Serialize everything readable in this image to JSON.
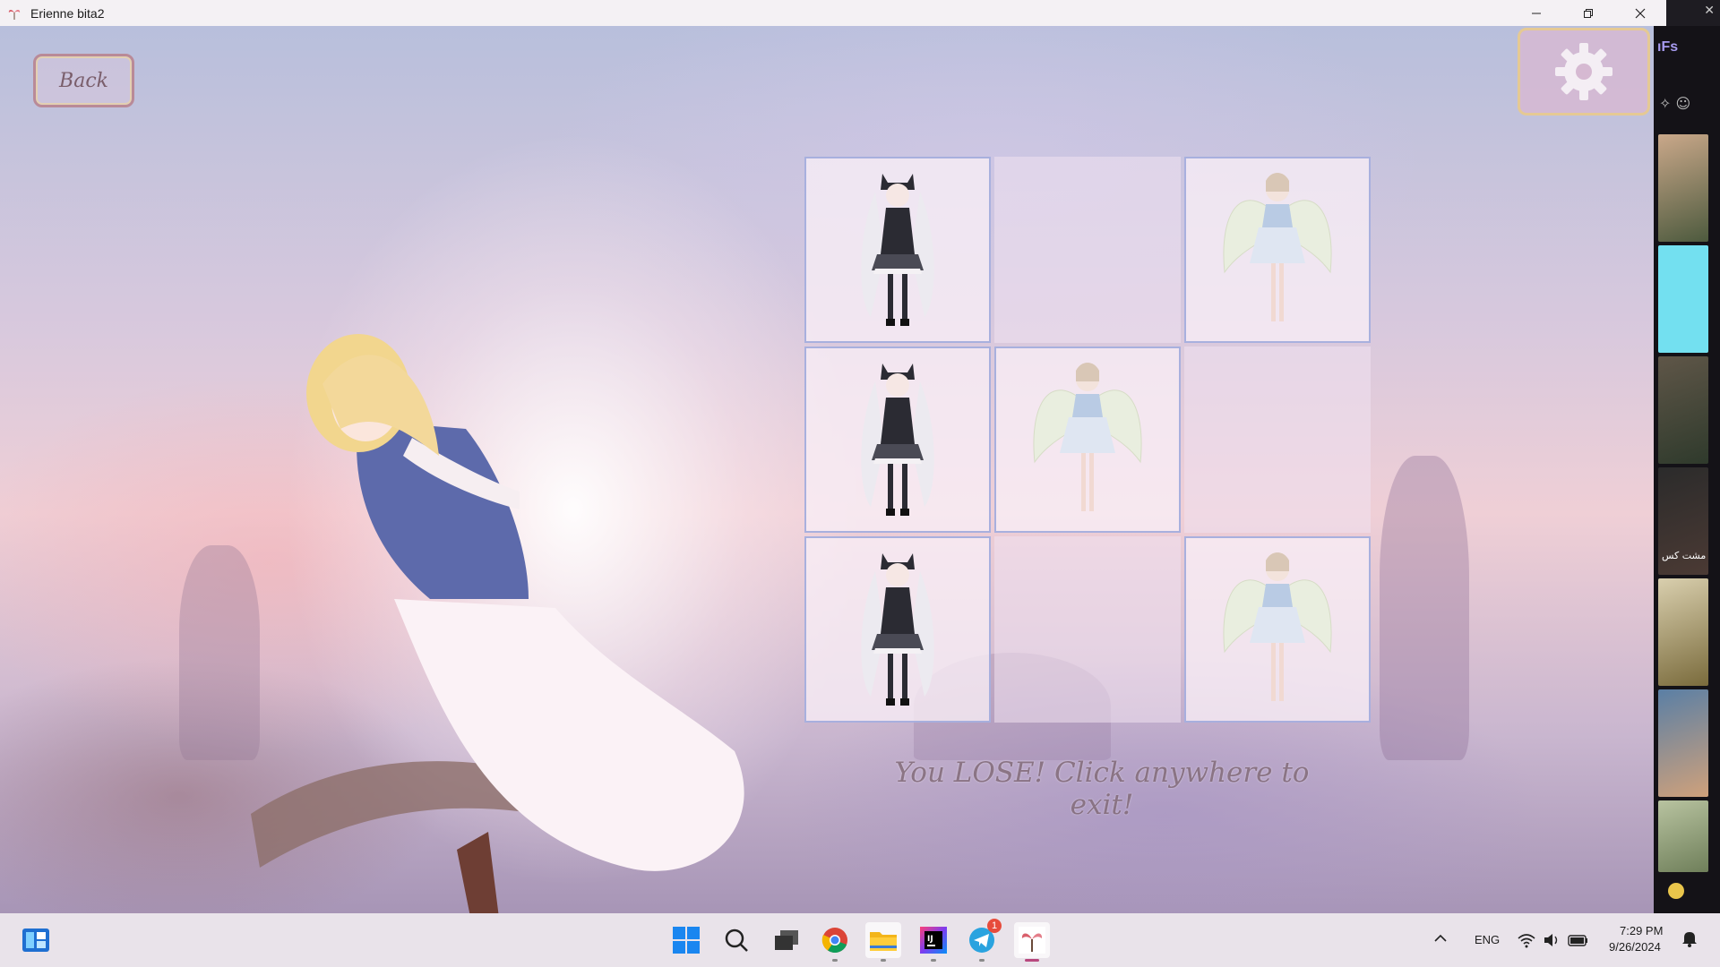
{
  "window": {
    "title": "Erienne bita2"
  },
  "game": {
    "back_label": "Back",
    "result_message": "You LOSE! Click anywhere to exit!",
    "board": [
      "cat",
      "empty",
      "angel",
      "cat",
      "angel",
      "empty",
      "cat",
      "empty",
      "angel"
    ]
  },
  "side_panel": {
    "label": "ifs",
    "caption": "یه مشت کس"
  },
  "taskbar": {
    "language": "ENG",
    "time": "7:29 PM",
    "date": "9/26/2024",
    "telegram_badge": "1"
  },
  "colors": {
    "accent": "#b8487e",
    "board_border": "#a0aadc"
  }
}
